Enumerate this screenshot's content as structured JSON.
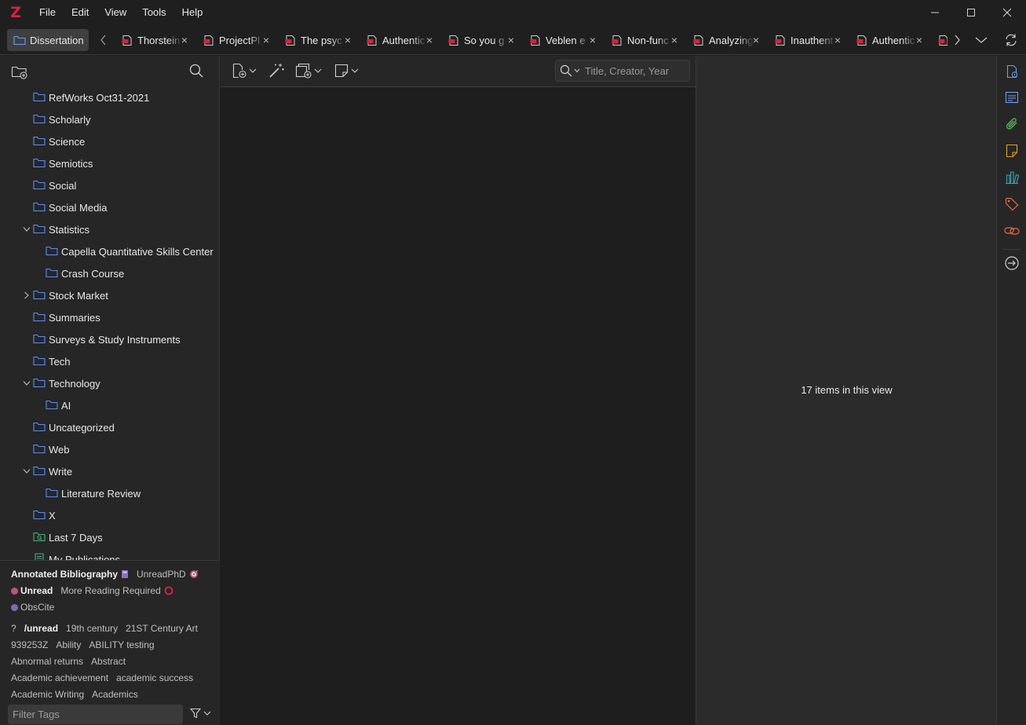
{
  "app": {
    "logo_letter": "Z",
    "accent": "#d8233a"
  },
  "menu": [
    "File",
    "Edit",
    "View",
    "Tools",
    "Help"
  ],
  "tabs": {
    "library_label": "Dissertation",
    "reader_tabs": [
      "Thorstein",
      "ProjectPl",
      "The psyc",
      "Authentic",
      "So you g",
      "Veblen e",
      "Non-func",
      "Analyzing",
      "Inauthent",
      "Authentic"
    ]
  },
  "collections": [
    {
      "label": "RefWorks Oct31-2021",
      "level": 1,
      "twisty": "",
      "icon": "folder-icon"
    },
    {
      "label": "Scholarly",
      "level": 1,
      "twisty": "",
      "icon": "folder-icon"
    },
    {
      "label": "Science",
      "level": 1,
      "twisty": "",
      "icon": "folder-icon"
    },
    {
      "label": "Semiotics",
      "level": 1,
      "twisty": "",
      "icon": "folder-icon"
    },
    {
      "label": "Social",
      "level": 1,
      "twisty": "",
      "icon": "folder-icon"
    },
    {
      "label": "Social Media",
      "level": 1,
      "twisty": "",
      "icon": "folder-icon"
    },
    {
      "label": "Statistics",
      "level": 1,
      "twisty": "open",
      "icon": "folder-icon"
    },
    {
      "label": "Capella Quantitative Skills Center",
      "level": 2,
      "twisty": "",
      "icon": "folder-icon"
    },
    {
      "label": "Crash Course",
      "level": 2,
      "twisty": "",
      "icon": "folder-icon"
    },
    {
      "label": "Stock Market",
      "level": 1,
      "twisty": "closed",
      "icon": "folder-icon"
    },
    {
      "label": "Summaries",
      "level": 1,
      "twisty": "",
      "icon": "folder-icon"
    },
    {
      "label": "Surveys & Study Instruments",
      "level": 1,
      "twisty": "",
      "icon": "folder-icon"
    },
    {
      "label": "Tech",
      "level": 1,
      "twisty": "",
      "icon": "folder-icon"
    },
    {
      "label": "Technology",
      "level": 1,
      "twisty": "open",
      "icon": "folder-icon"
    },
    {
      "label": "AI",
      "level": 2,
      "twisty": "",
      "icon": "folder-icon"
    },
    {
      "label": "Uncategorized",
      "level": 1,
      "twisty": "",
      "icon": "folder-icon"
    },
    {
      "label": "Web",
      "level": 1,
      "twisty": "",
      "icon": "folder-icon"
    },
    {
      "label": "Write",
      "level": 1,
      "twisty": "open",
      "icon": "folder-icon"
    },
    {
      "label": "Literature Review",
      "level": 2,
      "twisty": "",
      "icon": "folder-icon"
    },
    {
      "label": "X",
      "level": 1,
      "twisty": "",
      "icon": "folder-icon"
    },
    {
      "label": "Last 7 Days",
      "level": 1,
      "twisty": "",
      "icon": "saved-search-icon"
    },
    {
      "label": "My Publications",
      "level": 1,
      "twisty": "",
      "icon": "publications-icon"
    }
  ],
  "tags": {
    "lines": [
      [
        {
          "label": "Annotated Bibliography",
          "bold": true,
          "emoji": "book-emoji"
        },
        {
          "label": "UnreadPhD",
          "bold": false,
          "emoji": "target-emoji"
        }
      ],
      [
        {
          "label": "Unread",
          "bold": true,
          "dot": "#c0507f"
        },
        {
          "label": "More Reading Required",
          "bold": false,
          "emoji": "ring-emoji"
        }
      ],
      [
        {
          "label": "ObsCite",
          "bold": false,
          "dot": "#7d6bb0"
        }
      ],
      [
        {
          "label": "?",
          "bold": false
        },
        {
          "label": "/unread",
          "bold": true
        },
        {
          "label": "19th century",
          "bold": false
        },
        {
          "label": "21ST Century Art",
          "bold": false
        }
      ],
      [
        {
          "label": "939253Z",
          "bold": false
        },
        {
          "label": "Ability",
          "bold": false
        },
        {
          "label": "ABILITY testing",
          "bold": false
        }
      ],
      [
        {
          "label": "Abnormal returns",
          "bold": false
        },
        {
          "label": "Abstract",
          "bold": false
        }
      ],
      [
        {
          "label": "Academic achievement",
          "bold": false
        },
        {
          "label": "academic success",
          "bold": false
        }
      ],
      [
        {
          "label": "Academic Writing",
          "bold": false
        },
        {
          "label": "Academics",
          "bold": false
        }
      ]
    ],
    "filter_placeholder": "Filter Tags"
  },
  "items": {
    "search_placeholder": "Title, Creator, Year"
  },
  "item_pane": {
    "message": "17 items in this view"
  },
  "side_nav": [
    "info-icon",
    "abstract-icon",
    "attachments-icon",
    "notes-icon",
    "libraries-collections-icon",
    "tags-icon",
    "related-icon",
    "locate-icon"
  ],
  "colors": {
    "folder": "#5b8def",
    "saved_search": "#4caf7d",
    "pdf": "#d8233a",
    "attachment": "#59b35c",
    "note": "#e0a030",
    "tag": "#e86a40",
    "related": "#e86a40"
  }
}
